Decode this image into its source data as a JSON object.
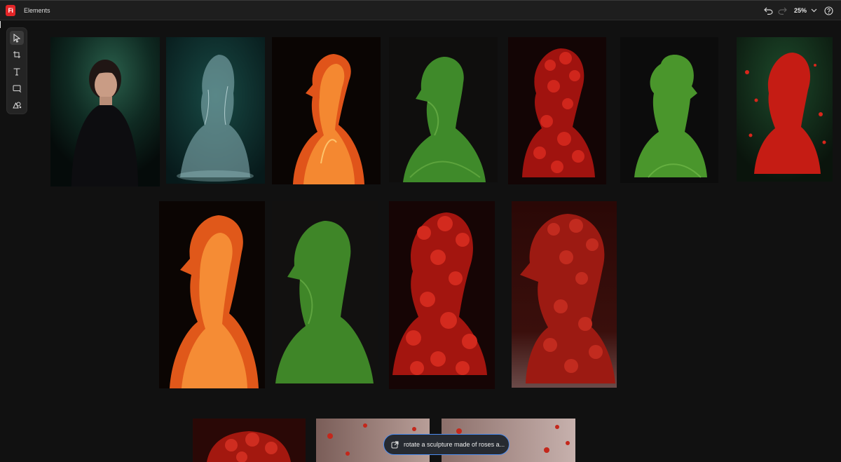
{
  "app": {
    "logo_text": "Fi",
    "document_title": "Elements"
  },
  "toolbar_top": {
    "zoom_label": "25%"
  },
  "tools": [
    {
      "name": "select-tool",
      "icon": "arrow-select-icon",
      "active": true
    },
    {
      "name": "frame-tool",
      "icon": "frame-icon",
      "active": false
    },
    {
      "name": "text-tool",
      "icon": "text-icon",
      "active": false
    },
    {
      "name": "shape-tool",
      "icon": "rectangle-icon",
      "active": false
    },
    {
      "name": "generate-tool",
      "icon": "shapes-generate-icon",
      "active": false
    }
  ],
  "prompt": {
    "text": "rotate a sculpture made of roses a..."
  },
  "colors": {
    "accent": "#4d8df0",
    "brand": "#e42527",
    "canvas": "#111111"
  }
}
